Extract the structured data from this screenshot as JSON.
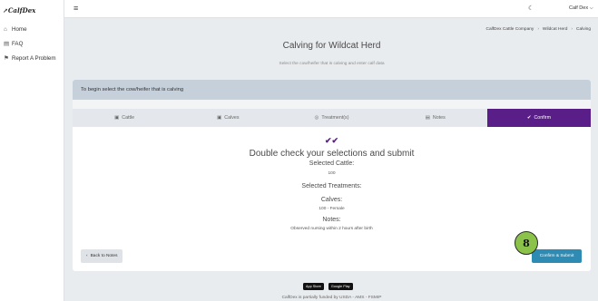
{
  "brand": {
    "logo_text": "↗CalfDex"
  },
  "sidebar": {
    "items": [
      {
        "label": "Home",
        "icon": "home-icon",
        "glyph": "⌂"
      },
      {
        "label": "FAQ",
        "icon": "book-icon",
        "glyph": "▤"
      },
      {
        "label": "Report A Problem",
        "icon": "report-icon",
        "glyph": "⚑"
      }
    ]
  },
  "topbar": {
    "menu_icon": "≡",
    "theme_icon": "☾",
    "user_label": "Calf Dex ⌵"
  },
  "breadcrumb": {
    "items": [
      "CalfDex Cattle Company",
      "Wildcat Herd",
      "Calving"
    ],
    "separator": "›"
  },
  "page": {
    "title": "Calving for Wildcat Herd",
    "subtitle": "Select the cow/heifer that is calving and enter calf data"
  },
  "card": {
    "header": "To begin select the cow/heifer that is calving"
  },
  "tabs": [
    {
      "label": "Cattle",
      "glyph": "▣",
      "active": false
    },
    {
      "label": "Calves",
      "glyph": "▣",
      "active": false
    },
    {
      "label": "Treatment(s)",
      "glyph": "◎",
      "active": false
    },
    {
      "label": "Notes",
      "glyph": "▤",
      "active": false
    },
    {
      "label": "Confirm",
      "glyph": "✔",
      "active": true
    }
  ],
  "confirm": {
    "check_glyph": "✔✔",
    "heading": "Double check your selections and submit",
    "cattle_label": "Selected Cattle:",
    "cattle_value": "100",
    "treatments_label": "Selected Treatments:",
    "calves_label": "Calves:",
    "calves_value": "100 - Female",
    "notes_label": "Notes:",
    "notes_value": "Observed nursing within 2 hours after birth"
  },
  "buttons": {
    "back_glyph": "‹",
    "back_label": "Back to Notes",
    "submit_label": "Confirm & Submit"
  },
  "step_badge": "8",
  "store_badges": [
    "App Store",
    "Google Play"
  ],
  "footer": "CalfDex is partially funded by USDA - AMS - FSMIP",
  "colors": {
    "accent_purple": "#5a1e89",
    "submit_blue": "#2e8bb3",
    "step_green": "#8bc34a",
    "header_gray": "#c5d0da"
  }
}
